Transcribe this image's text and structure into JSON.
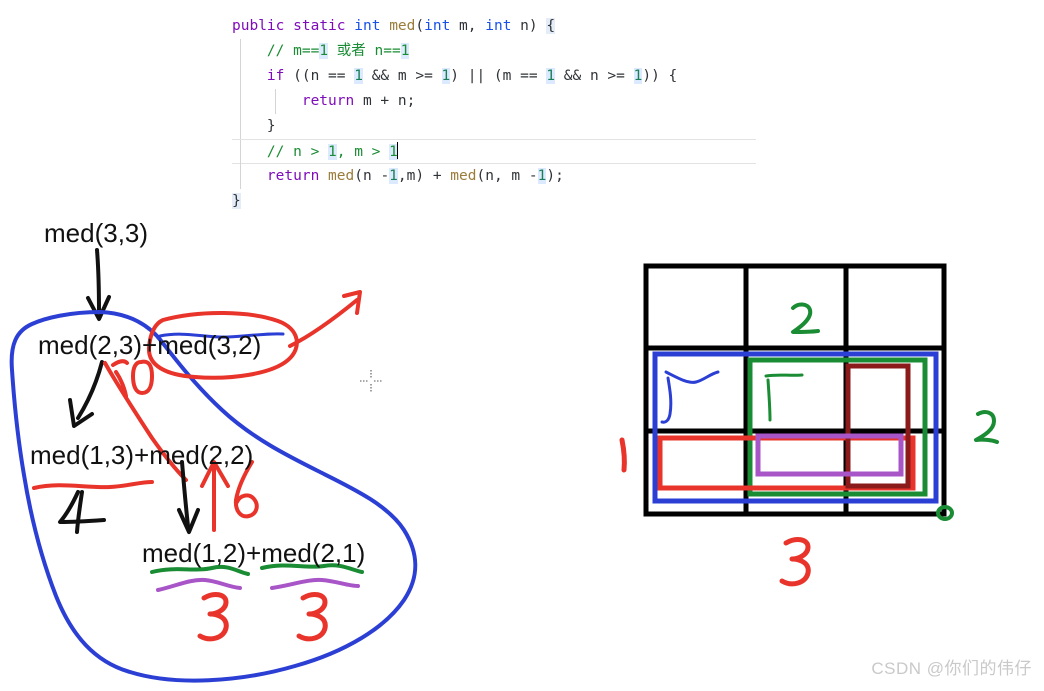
{
  "code": {
    "language": "java",
    "lines": [
      {
        "id": "line-signature",
        "tokens": [
          {
            "t": "public",
            "c": "kw"
          },
          {
            "t": " ",
            "c": "plain"
          },
          {
            "t": "static",
            "c": "kw"
          },
          {
            "t": " ",
            "c": "plain"
          },
          {
            "t": "int",
            "c": "type"
          },
          {
            "t": " ",
            "c": "plain"
          },
          {
            "t": "med",
            "c": "ident"
          },
          {
            "t": "(",
            "c": "plain"
          },
          {
            "t": "int",
            "c": "type"
          },
          {
            "t": " m, ",
            "c": "plain"
          },
          {
            "t": "int",
            "c": "type"
          },
          {
            "t": " n) ",
            "c": "plain"
          },
          {
            "t": "{",
            "c": "brace-hl"
          }
        ]
      },
      {
        "id": "line-comment-1",
        "tokens": [
          {
            "t": "    // m==",
            "c": "cmt"
          },
          {
            "t": "1",
            "c": "cmt-num"
          },
          {
            "t": " 或者 n==",
            "c": "cmt"
          },
          {
            "t": "1",
            "c": "cmt-num"
          }
        ]
      },
      {
        "id": "line-if",
        "tokens": [
          {
            "t": "    ",
            "c": "plain"
          },
          {
            "t": "if",
            "c": "kw"
          },
          {
            "t": " ((n == ",
            "c": "plain"
          },
          {
            "t": "1",
            "c": "num"
          },
          {
            "t": " && m >= ",
            "c": "plain"
          },
          {
            "t": "1",
            "c": "num"
          },
          {
            "t": ") || (m == ",
            "c": "plain"
          },
          {
            "t": "1",
            "c": "num"
          },
          {
            "t": " && n >= ",
            "c": "plain"
          },
          {
            "t": "1",
            "c": "num"
          },
          {
            "t": ")) {",
            "c": "plain"
          }
        ]
      },
      {
        "id": "line-return-mn",
        "tokens": [
          {
            "t": "        ",
            "c": "plain"
          },
          {
            "t": "return",
            "c": "kw"
          },
          {
            "t": " m + n;",
            "c": "plain"
          }
        ]
      },
      {
        "id": "line-close-if",
        "tokens": [
          {
            "t": "    }",
            "c": "plain"
          }
        ]
      },
      {
        "id": "line-comment-2",
        "current": true,
        "caret": true,
        "tokens": [
          {
            "t": "    // n > ",
            "c": "cmt"
          },
          {
            "t": "1",
            "c": "cmt-num"
          },
          {
            "t": ", m > ",
            "c": "cmt"
          },
          {
            "t": "1",
            "c": "cmt-num"
          }
        ]
      },
      {
        "id": "line-return-rec",
        "tokens": [
          {
            "t": "    ",
            "c": "plain"
          },
          {
            "t": "return",
            "c": "kw"
          },
          {
            "t": " ",
            "c": "plain"
          },
          {
            "t": "med",
            "c": "ident"
          },
          {
            "t": "(n -",
            "c": "plain"
          },
          {
            "t": "1",
            "c": "num"
          },
          {
            "t": ",m) + ",
            "c": "plain"
          },
          {
            "t": "med",
            "c": "ident"
          },
          {
            "t": "(n, m -",
            "c": "plain"
          },
          {
            "t": "1",
            "c": "num"
          },
          {
            "t": ");",
            "c": "plain"
          }
        ]
      },
      {
        "id": "line-close-method",
        "tokens": [
          {
            "t": "}",
            "c": "brace-hl"
          }
        ]
      }
    ]
  },
  "tree": {
    "title": "recursion-expansion-tree",
    "nodes": [
      {
        "id": "med33",
        "label": "med(3,3)"
      },
      {
        "id": "med23",
        "label": "med(2,3)+med(3,2)"
      },
      {
        "id": "med13",
        "label": "med(1,3)+med(2,2)"
      },
      {
        "id": "med12",
        "label": "med(1,2)+med(2,1)"
      }
    ],
    "annotations": [
      {
        "id": "ann-10",
        "text": "10",
        "color": "#e8342a",
        "note": "red handwritten 10 under med(2,3)"
      },
      {
        "id": "ann-4",
        "text": "4",
        "color": "#111111",
        "note": "black handwritten 4 under med(1,3)"
      },
      {
        "id": "ann-6",
        "text": "6",
        "color": "#e8342a",
        "note": "red handwritten 6 near med(2,2)"
      },
      {
        "id": "ann-3-left",
        "text": "3",
        "color": "#e8342a",
        "note": "red handwritten 3 under med(1,2)"
      },
      {
        "id": "ann-3-right",
        "text": "3",
        "color": "#e8342a",
        "note": "red handwritten 3 under med(2,1)"
      }
    ]
  },
  "grid": {
    "title": "3x3-path-grid",
    "rows": 3,
    "cols": 3,
    "cells": [
      [
        "",
        "",
        ""
      ],
      [
        "",
        "",
        ""
      ],
      [
        "",
        "",
        ""
      ]
    ],
    "annotations": [
      {
        "id": "grid-ann-2-top",
        "text": "2",
        "color": "#1a8c34",
        "note": "green 2 in top middle cell"
      },
      {
        "id": "grid-ann-1-left",
        "text": "1",
        "color": "#e8342a",
        "note": "red 1 left of grid"
      },
      {
        "id": "grid-ann-2-right",
        "text": "2",
        "color": "#1a8c34",
        "note": "green 2 right of grid"
      },
      {
        "id": "grid-ann-3-bottom",
        "text": "3",
        "color": "#e8342a",
        "note": "red 3 below grid"
      }
    ],
    "overlay_rects": [
      {
        "id": "rect-blue",
        "color": "#2b3fd4",
        "note": "blue rectangle spanning rows 2-3, cols 1-3"
      },
      {
        "id": "rect-green",
        "color": "#1a8c34",
        "note": "green rectangle spanning rows 2-3, cols 2-3"
      },
      {
        "id": "rect-red",
        "color": "#e8342a",
        "note": "red rectangle spanning row 3, cols 1-3"
      },
      {
        "id": "rect-darkred",
        "color": "#8b1a1a",
        "note": "dark red rectangle spanning rows 2-3, col 3"
      },
      {
        "id": "rect-purple",
        "color": "#a855c8",
        "note": "purple rectangle spanning row 3, cols 2-3"
      }
    ]
  },
  "colors": {
    "blue": "#2b3fd4",
    "red": "#e8342a",
    "green": "#1a8c34",
    "purple": "#a855c8",
    "dark_red": "#8b1a1a",
    "black": "#111111",
    "keyword": "#7f0cbb",
    "type": "#1750eb",
    "identifier": "#9a7d3a",
    "number": "#1a7f56",
    "comment": "#1a8c34",
    "watermark": "#c9c9c9"
  },
  "watermark": {
    "text": "CSDN @你们的伟仔"
  }
}
